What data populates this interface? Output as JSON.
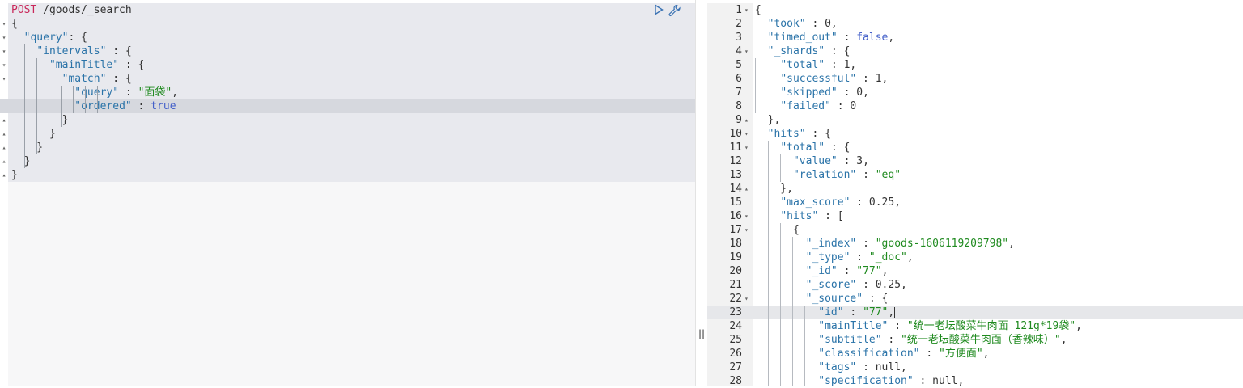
{
  "request": {
    "method": "POST",
    "path": " /goods/_search",
    "lines": [
      "{",
      "  \"query\": {",
      "    \"intervals\" : {",
      "      \"mainTitle\" : {",
      "        \"match\" : {",
      "          \"query\" : \"面袋\",",
      "          \"ordered\" : true",
      "        }",
      "      }",
      "    }",
      "  }",
      "}"
    ]
  },
  "actions": {
    "run_icon": "play-icon",
    "settings_icon": "wrench-icon"
  },
  "divider": {
    "handle": "||"
  },
  "response": {
    "line_numbers": [
      "1",
      "2",
      "3",
      "4",
      "5",
      "6",
      "7",
      "8",
      "9",
      "10",
      "11",
      "12",
      "13",
      "14",
      "15",
      "16",
      "17",
      "18",
      "19",
      "20",
      "21",
      "22",
      "23",
      "24",
      "25",
      "26",
      "27",
      "28"
    ],
    "lines": [
      "{",
      "  \"took\" : 0,",
      "  \"timed_out\" : false,",
      "  \"_shards\" : {",
      "    \"total\" : 1,",
      "    \"successful\" : 1,",
      "    \"skipped\" : 0,",
      "    \"failed\" : 0",
      "  },",
      "  \"hits\" : {",
      "    \"total\" : {",
      "      \"value\" : 3,",
      "      \"relation\" : \"eq\"",
      "    },",
      "    \"max_score\" : 0.25,",
      "    \"hits\" : [",
      "      {",
      "        \"_index\" : \"goods-1606119209798\",",
      "        \"_type\" : \"_doc\",",
      "        \"_id\" : \"77\",",
      "        \"_score\" : 0.25,",
      "        \"_source\" : {",
      "          \"id\" : \"77\",",
      "          \"mainTitle\" : \"统一老坛酸菜牛肉面 121g*19袋\",",
      "          \"subtitle\" : \"统一老坛酸菜牛肉面（香辣味）\",",
      "          \"classification\" : \"方便面\",",
      "          \"tags\" : null,",
      "          \"specification\" : null,"
    ]
  },
  "colors": {
    "key": "#2a73a8",
    "string": "#1f8a1f",
    "bool": "#4460c9",
    "method": "#c9285a"
  }
}
